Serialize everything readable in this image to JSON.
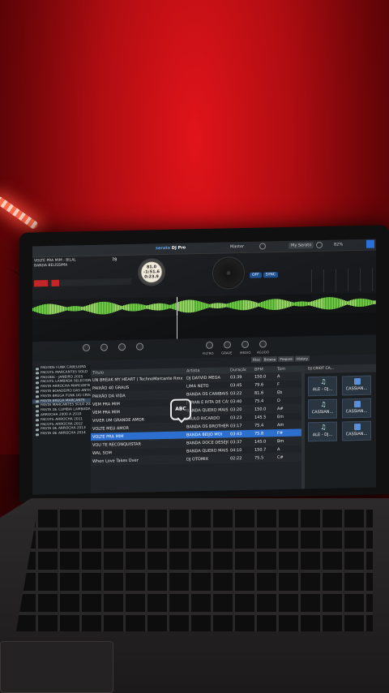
{
  "topbar": {
    "app": "serato",
    "product": "DJ Pro",
    "master_label": "Master",
    "user_label": "My Serato",
    "battery": "82%"
  },
  "deck": {
    "track_title": "VOLTE PRA MIM - BILAL",
    "track_artist": "BANDA BELÍSSIMA",
    "bpm": "78",
    "platter_top": "81.0",
    "platter_mid": "-1:51.6",
    "platter_bot": "0:23.9",
    "sync_off": "OFF",
    "sync_on": "SYNC"
  },
  "fx": {
    "labels": [
      "FILTRO",
      "GRAVE",
      "MEDIO",
      "AGUDO"
    ]
  },
  "library_tabs": [
    "Files",
    "Browse",
    "Prepare",
    "History"
  ],
  "crates": [
    "PAGODE FUNK CABELEIRA",
    "PACOTE MARCANTES SOLO",
    "PAGODE - JANEIRO 2025",
    "PACOTE LAMBADA SELECIONADA",
    "PASTA ARROCHA MARCANTE",
    "PASTA BOIADEIRO DAS ANTIGAS",
    "PASTA BREGA FUNK DO CRIS",
    "PASTA BREGA MARCANTE",
    "PASTA MARCANTES SOLO 2025",
    "PASTA DE CUMBIA LAMBADA",
    "ARROCHA 2000 A 2010",
    "PACOTE ARROCHA 2011",
    "PACOTE ARROCHA 2012",
    "PASTA DE ARROCHA 2013",
    "PASTA DE ARROCHA 2014"
  ],
  "tracklist": {
    "columns": {
      "title": "Título",
      "artist": "Artista",
      "duration": "Duração",
      "bpm": "BPM",
      "key": "Tom"
    },
    "rows": [
      {
        "title": "UN BREAK MY HEART | TechnoMarcante Rmx 2025",
        "artist": "DJ DAYVID MEGA",
        "duration": "03:39",
        "bpm": "150.0",
        "key": "A"
      },
      {
        "title": "PAIXÃO 40 GRAUS",
        "artist": "LIMA NETO",
        "duration": "03:45",
        "bpm": "79.6",
        "key": "F"
      },
      {
        "title": "PAIXÃO DA VIDA",
        "artist": "BANDA OS CANIBAIS",
        "duration": "03:22",
        "bpm": "81.6",
        "key": "Eb"
      },
      {
        "title": "VEM PRA MIM",
        "artist": "J. IRAN E RITA DE CÁSSIA",
        "duration": "03:40",
        "bpm": "75.4",
        "key": "D"
      },
      {
        "title": "VEM PRA MIM",
        "artist": "BANDA QUERO MAIS",
        "duration": "03:20",
        "bpm": "150.0",
        "key": "A#"
      },
      {
        "title": "VIVER UM GRANDE AMOR",
        "artist": "PAULO RICARDO",
        "duration": "03:23",
        "bpm": "145.5",
        "key": "Em"
      },
      {
        "title": "VOLTE MEU AMOR",
        "artist": "BANDA OS BROTHERS",
        "duration": "03:17",
        "bpm": "75.4",
        "key": "Am"
      },
      {
        "title": "VOLTE PRA MIM",
        "artist": "BANDA BEIJO MOI",
        "duration": "03:43",
        "bpm": "75.8",
        "key": "F#",
        "selected": true
      },
      {
        "title": "VOU TE RECONQUISTAR",
        "artist": "BANDA DOCE DESEJO",
        "duration": "03:37",
        "bpm": "145.0",
        "key": "Bm"
      },
      {
        "title": "WAL SOM",
        "artist": "BANDA QUERO MAIS",
        "duration": "04:10",
        "bpm": "150.7",
        "key": "A"
      },
      {
        "title": "When Love Takes Over",
        "artist": "DJ OTOMIX",
        "duration": "02:22",
        "bpm": "75.5",
        "key": "C#"
      }
    ]
  },
  "sampler": {
    "header": "DJ CRIOT CA...",
    "slots": [
      "ALE - DJ...",
      "CASSIAN...",
      "CASSIAN...",
      "CASSIAN...",
      "ALE - DJ...",
      "CASSIAN..."
    ]
  },
  "overlay_badge": "ABC"
}
